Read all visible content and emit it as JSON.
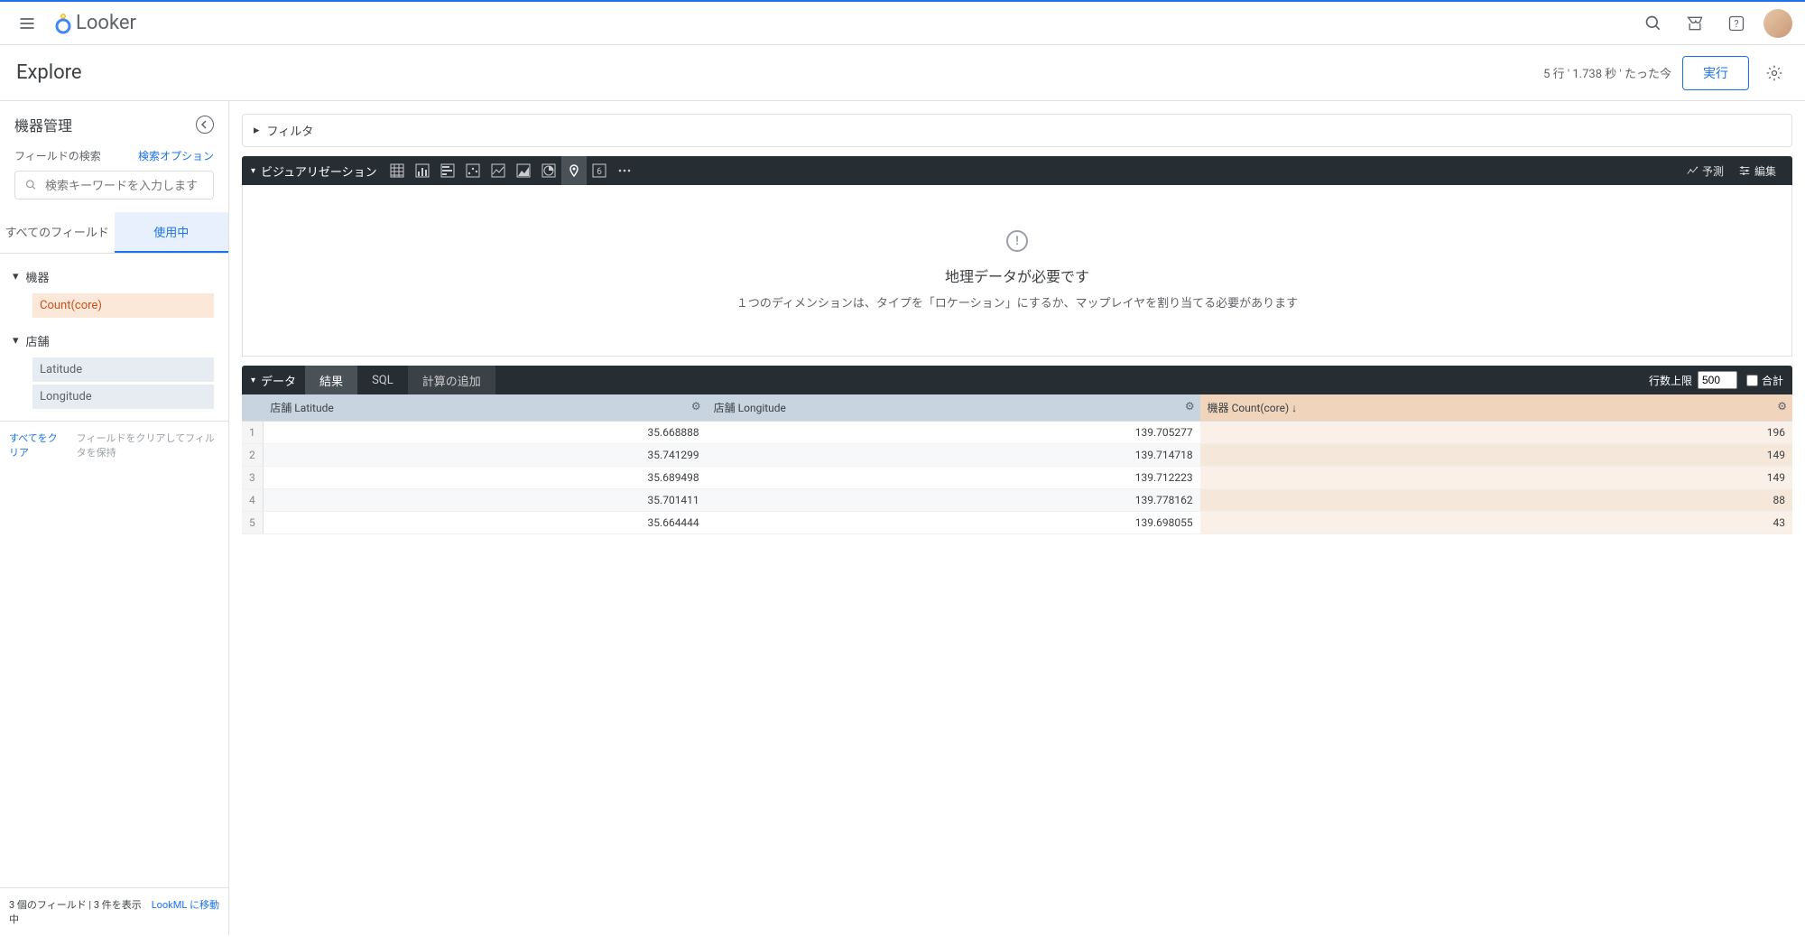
{
  "topbar": {
    "brand": "Looker"
  },
  "subheader": {
    "title": "Explore",
    "status": "5 行 ' 1.738 秒 ' たった今",
    "run": "実行"
  },
  "sidebar": {
    "title": "機器管理",
    "search_label": "フィールドの検索",
    "search_options": "検索オプション",
    "search_placeholder": "検索キーワードを入力します",
    "tabs": {
      "all": "すべてのフィールド",
      "in_use": "使用中"
    },
    "groups": [
      {
        "name": "機器",
        "fields": [
          {
            "label": "Count(core)",
            "type": "measure"
          }
        ]
      },
      {
        "name": "店舗",
        "fields": [
          {
            "label": "Latitude",
            "type": "dimension"
          },
          {
            "label": "Longitude",
            "type": "dimension"
          }
        ]
      }
    ],
    "clear_all": "すべてをクリア",
    "clear_keep_filters": "フィールドをクリアしてフィルタを保持",
    "footer_status": "3 個のフィールド | 3 件を表示中",
    "lookml_link": "LookML に移動"
  },
  "panels": {
    "filter": "フィルタ",
    "viz": "ビジュアリゼーション",
    "forecast": "予測",
    "edit": "編集",
    "data": "データ",
    "data_tabs": {
      "results": "結果",
      "sql": "SQL",
      "add_calc": "計算の追加"
    },
    "row_limit_label": "行数上限",
    "row_limit_value": "500",
    "total_label": "合計"
  },
  "viz_message": {
    "title": "地理データが必要です",
    "subtitle": "１つのディメンションは、タイプを「ロケーション」にするか、マップレイヤを割り当てる必要があります"
  },
  "table": {
    "headers": {
      "latitude": "店舗 Latitude",
      "longitude": "店舗 Longitude",
      "count": "機器 Count(core) ↓"
    },
    "rows": [
      {
        "n": "1",
        "lat": "35.668888",
        "lon": "139.705277",
        "cnt": "196"
      },
      {
        "n": "2",
        "lat": "35.741299",
        "lon": "139.714718",
        "cnt": "149"
      },
      {
        "n": "3",
        "lat": "35.689498",
        "lon": "139.712223",
        "cnt": "149"
      },
      {
        "n": "4",
        "lat": "35.701411",
        "lon": "139.778162",
        "cnt": "88"
      },
      {
        "n": "5",
        "lat": "35.664444",
        "lon": "139.698055",
        "cnt": "43"
      }
    ]
  }
}
